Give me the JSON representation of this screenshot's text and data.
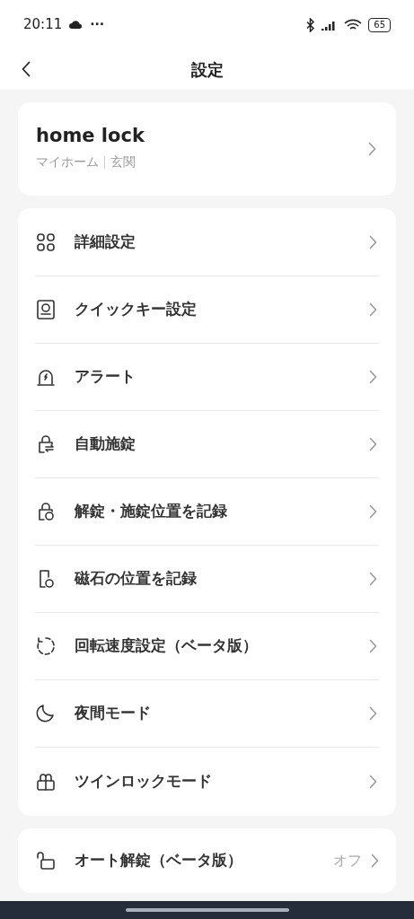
{
  "status_bar": {
    "time": "20:11",
    "more": "···",
    "battery": "65"
  },
  "header": {
    "title": "設定"
  },
  "device": {
    "name": "home lock",
    "home": "マイホーム",
    "room": "玄関"
  },
  "menu": [
    {
      "label": "詳細設定"
    },
    {
      "label": "クイックキー設定"
    },
    {
      "label": "アラート"
    },
    {
      "label": "自動施錠"
    },
    {
      "label": "解錠・施錠位置を記録"
    },
    {
      "label": "磁石の位置を記録"
    },
    {
      "label": "回転速度設定（ベータ版）"
    },
    {
      "label": "夜間モード"
    },
    {
      "label": "ツインロックモード"
    }
  ],
  "auto_unlock": {
    "label": "オート解錠（ベータ版）",
    "value": "オフ"
  }
}
